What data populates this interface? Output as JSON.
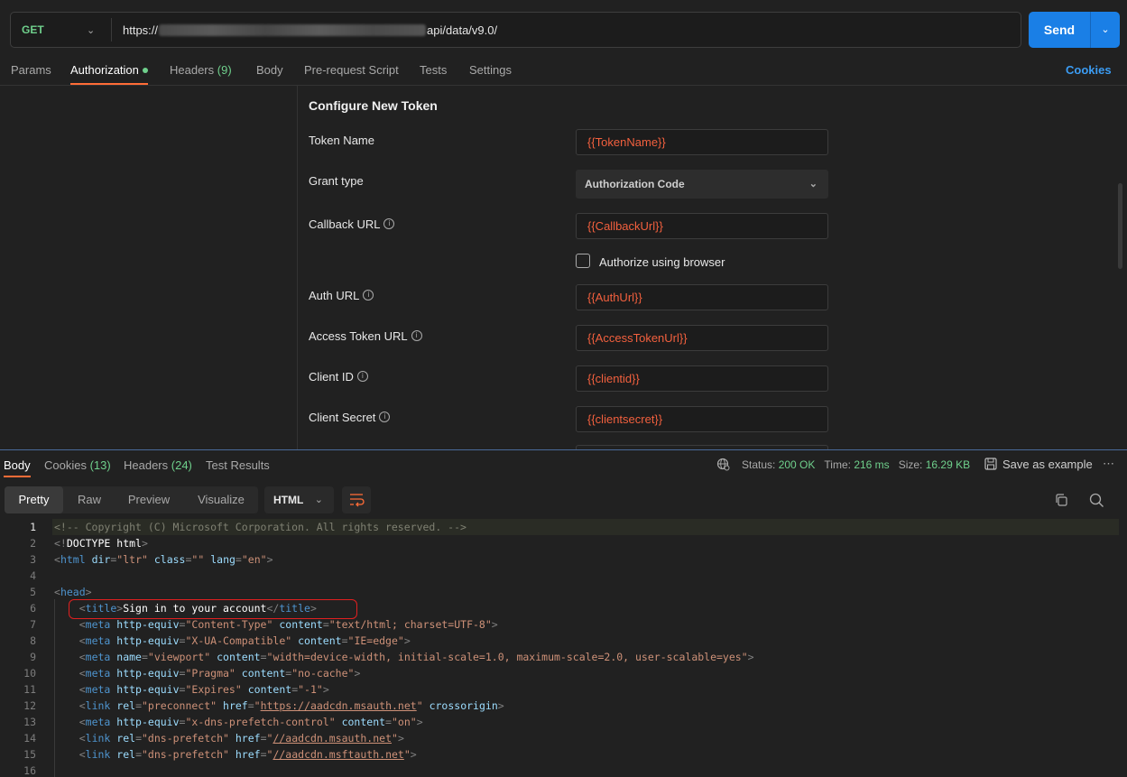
{
  "request": {
    "method": "GET",
    "url_prefix": "https://",
    "url_suffix": "api/data/v9.0/",
    "send_label": "Send"
  },
  "request_tabs": [
    {
      "label": "Params"
    },
    {
      "label": "Authorization"
    },
    {
      "label": "Headers",
      "count": "(9)"
    },
    {
      "label": "Body"
    },
    {
      "label": "Pre-request Script"
    },
    {
      "label": "Tests"
    },
    {
      "label": "Settings"
    }
  ],
  "cookies_link": "Cookies",
  "auth": {
    "section_title": "Configure New Token",
    "token_name_label": "Token Name",
    "token_name_value": "{{TokenName}}",
    "grant_type_label": "Grant type",
    "grant_type_value": "Authorization Code",
    "callback_url_label": "Callback URL",
    "callback_url_value": "{{CallbackUrl}}",
    "authorize_browser_label": "Authorize using browser",
    "authorize_browser_checked": false,
    "auth_url_label": "Auth URL",
    "auth_url_value": "{{AuthUrl}}",
    "access_token_url_label": "Access Token URL",
    "access_token_url_value": "{{AccessTokenUrl}}",
    "client_id_label": "Client ID",
    "client_id_value": "{{clientid}}",
    "client_secret_label": "Client Secret",
    "client_secret_value": "{{clientsecret}}"
  },
  "response_tabs": [
    {
      "label": "Body"
    },
    {
      "label": "Cookies",
      "count": "(13)"
    },
    {
      "label": "Headers",
      "count": "(24)"
    },
    {
      "label": "Test Results"
    }
  ],
  "response_status": {
    "status_label": "Status:",
    "status_value": "200 OK",
    "time_label": "Time:",
    "time_value": "216 ms",
    "size_label": "Size:",
    "size_value": "16.29 KB",
    "save_example": "Save as example"
  },
  "view_modes": [
    "Pretty",
    "Raw",
    "Preview",
    "Visualize"
  ],
  "format": "HTML",
  "code_lines": [
    {
      "n": "1",
      "text": "<!-- Copyright (C) Microsoft Corporation. All rights reserved. -->"
    },
    {
      "n": "2",
      "text": "<!DOCTYPE html>"
    },
    {
      "n": "3",
      "text": "<html dir=\"ltr\" class=\"\" lang=\"en\">"
    },
    {
      "n": "4",
      "text": ""
    },
    {
      "n": "5",
      "text": "<head>"
    },
    {
      "n": "6",
      "text": "    <title>Sign in to your account</title>"
    },
    {
      "n": "7",
      "text": "    <meta http-equiv=\"Content-Type\" content=\"text/html; charset=UTF-8\">"
    },
    {
      "n": "8",
      "text": "    <meta http-equiv=\"X-UA-Compatible\" content=\"IE=edge\">"
    },
    {
      "n": "9",
      "text": "    <meta name=\"viewport\" content=\"width=device-width, initial-scale=1.0, maximum-scale=2.0, user-scalable=yes\">"
    },
    {
      "n": "10",
      "text": "    <meta http-equiv=\"Pragma\" content=\"no-cache\">"
    },
    {
      "n": "11",
      "text": "    <meta http-equiv=\"Expires\" content=\"-1\">"
    },
    {
      "n": "12",
      "text": "    <link rel=\"preconnect\" href=\"https://aadcdn.msauth.net\" crossorigin>"
    },
    {
      "n": "13",
      "text": "    <meta http-equiv=\"x-dns-prefetch-control\" content=\"on\">"
    },
    {
      "n": "14",
      "text": "    <link rel=\"dns-prefetch\" href=\"//aadcdn.msauth.net\">"
    },
    {
      "n": "15",
      "text": "    <link rel=\"dns-prefetch\" href=\"//aadcdn.msftauth.net\">"
    },
    {
      "n": "16",
      "text": ""
    }
  ],
  "colors": {
    "accent_orange": "#ff6c37",
    "send_blue": "#1a7fe6",
    "link_blue": "#3b9cf3",
    "success_green": "#6fd08c",
    "variable_red": "#f2603e",
    "highlight_red": "#e02020"
  }
}
